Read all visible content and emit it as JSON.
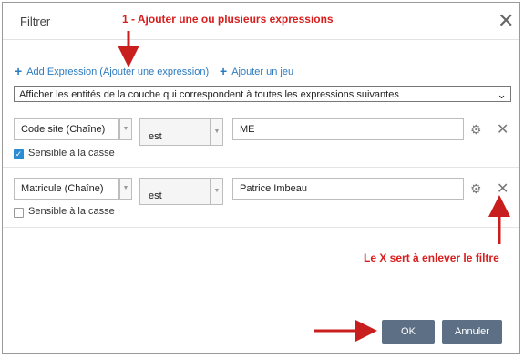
{
  "dialog": {
    "title": "Filtrer",
    "close_glyph": "✕",
    "add_expression_label": "Add Expression (Ajouter une expression)",
    "add_set_label": "Ajouter un jeu",
    "match_select_value": "Afficher les entités de la couche qui correspondent à toutes les expressions suivantes",
    "buttons": {
      "ok": "OK",
      "cancel": "Annuler"
    }
  },
  "expressions": [
    {
      "field": "Code site (Chaîne)",
      "operator": "est",
      "value": "ME",
      "case_sensitive_label": "Sensible à la casse",
      "case_sensitive": true
    },
    {
      "field": "Matricule (Chaîne)",
      "operator": "est",
      "value": "Patrice Imbeau",
      "case_sensitive_label": "Sensible à la casse",
      "case_sensitive": false
    }
  ],
  "annotations": {
    "step1": "1 - Ajouter une ou plusieurs expressions",
    "x_note": "Le X sert à  enlever le filtre"
  },
  "icons": {
    "plus": "plus-icon",
    "gear": "gear-icon",
    "close": "close-icon",
    "chevron": "chevron-down-icon"
  },
  "colors": {
    "accent": "#2c7bbf",
    "annotation": "#d81e1e",
    "button": "#5d6f85",
    "checkbox": "#2b8bd3"
  }
}
